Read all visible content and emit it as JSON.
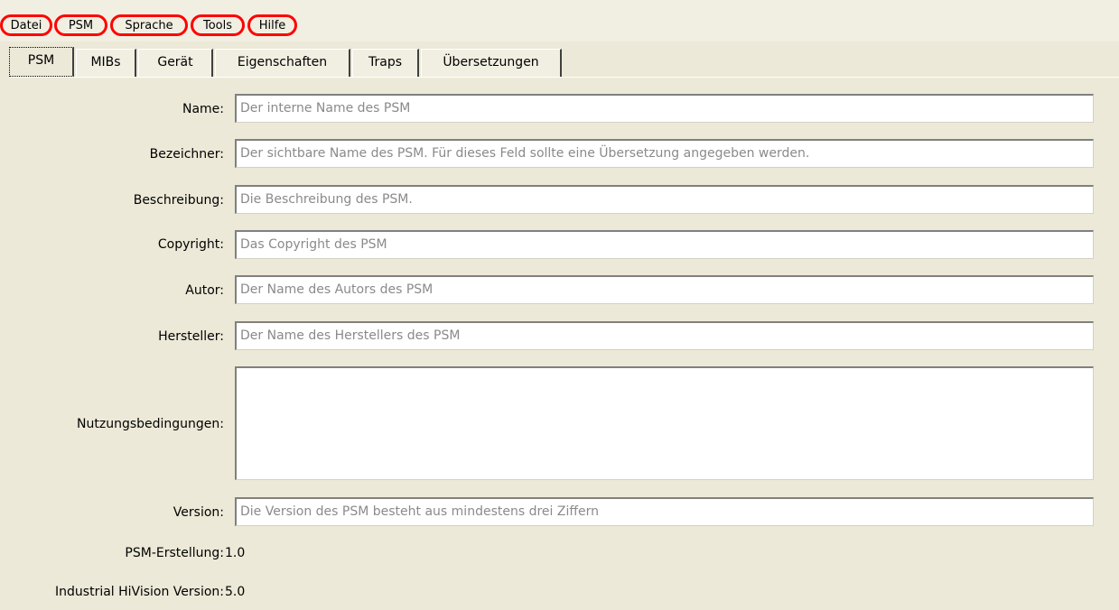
{
  "menu": [
    "Datei",
    "PSM",
    "Sprache",
    "Tools",
    "Hilfe"
  ],
  "tabs": [
    "PSM",
    "MIBs",
    "Gerät",
    "Eigenschaften",
    "Traps",
    "Übersetzungen"
  ],
  "form": {
    "name": {
      "label": "Name:",
      "placeholder": "Der interne Name des PSM"
    },
    "bezeichner": {
      "label": "Bezeichner:",
      "placeholder": "Der sichtbare Name des PSM. Für dieses Feld sollte eine Übersetzung angegeben werden."
    },
    "beschreibung": {
      "label": "Beschreibung:",
      "placeholder": "Die Beschreibung des PSM."
    },
    "copyright": {
      "label": "Copyright:",
      "placeholder": "Das Copyright des PSM"
    },
    "autor": {
      "label": "Autor:",
      "placeholder": "Der Name des Autors des PSM"
    },
    "hersteller": {
      "label": "Hersteller:",
      "placeholder": "Der Name des Herstellers des PSM"
    },
    "nutzungsbedingungen": {
      "label": "Nutzungsbedingungen:",
      "value": ""
    },
    "version": {
      "label": "Version:",
      "placeholder": "Die Version des PSM besteht aus mindestens drei Ziffern"
    },
    "psm_erstellung": {
      "label": "PSM-Erstellung:",
      "value": "1.0"
    },
    "hivision_version": {
      "label": "Industrial HiVision Version:",
      "value": "5.0"
    }
  },
  "colors": {
    "window_bg": "#ece9d8",
    "highlight_ring": "#ff0000",
    "placeholder_text": "#8a8a8a"
  }
}
